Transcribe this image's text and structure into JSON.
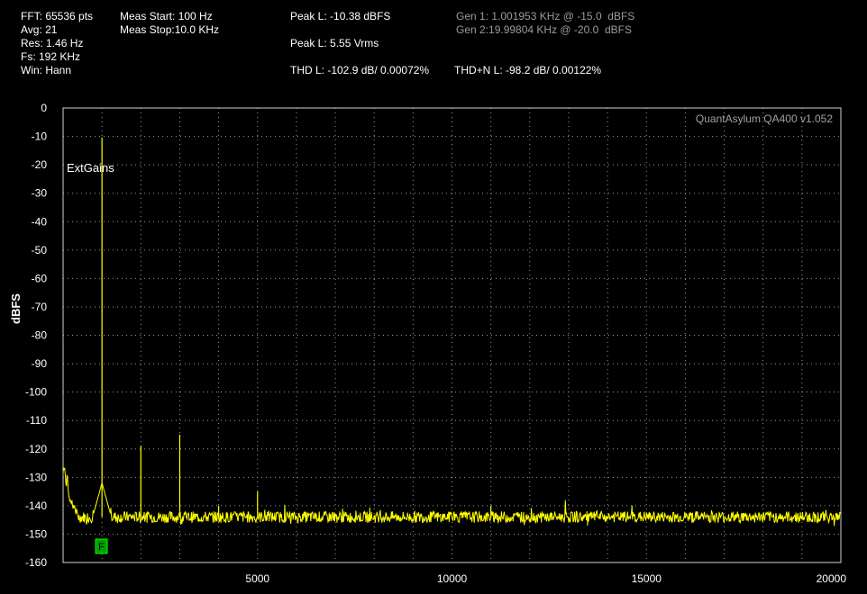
{
  "header": {
    "fft": "FFT: 65536 pts",
    "avg": "Avg: 21",
    "res": "Res: 1.46 Hz",
    "fs": "Fs: 192 KHz",
    "win": "Win: Hann",
    "meas_start": "Meas Start: 100 Hz",
    "meas_stop": "Meas Stop:10.0 KHz",
    "peak_dbfs": "Peak L: -10.38 dBFS",
    "peak_vrms": "Peak L: 5.55 Vrms",
    "thd": "THD L: -102.9 dB/ 0.00072%",
    "thdn": "THD+N L: -98.2 dB/ 0.00122%",
    "gen1": "Gen 1: 1.001953 KHz @ -15.0  dBFS",
    "gen2": "Gen 2:19.99804 KHz @ -20.0  dBFS"
  },
  "plot": {
    "watermark": "QuantAsylum QA400 v1.052",
    "annotation": "ExtGains",
    "marker_label": "F",
    "ylabel": "dBFS"
  },
  "colors": {
    "trace": "#ffff00",
    "grid": "#9a9a9a",
    "marker": "#00a000"
  },
  "chart_data": {
    "type": "line",
    "xlim": [
      0,
      20000
    ],
    "ylim": [
      -160,
      0
    ],
    "xticks": [
      5000,
      10000,
      15000,
      20000
    ],
    "yticks": [
      0,
      -10,
      -20,
      -30,
      -40,
      -50,
      -60,
      -70,
      -80,
      -90,
      -100,
      -110,
      -120,
      -130,
      -140,
      -150,
      -160
    ],
    "grid": true,
    "noise_floor": -144,
    "series": [
      {
        "peaks": [
          {
            "x": 1000,
            "y": -10.4
          },
          {
            "x": 2000,
            "y": -119
          },
          {
            "x": 3000,
            "y": -115
          },
          {
            "x": 4000,
            "y": -140
          },
          {
            "x": 5000,
            "y": -135
          },
          {
            "x": 11000,
            "y": -140
          }
        ]
      }
    ]
  }
}
